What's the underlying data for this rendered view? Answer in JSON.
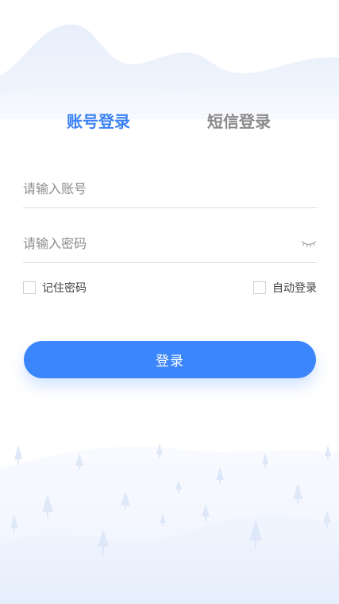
{
  "tabs": {
    "account_login": "账号登录",
    "sms_login": "短信登录"
  },
  "form": {
    "account_placeholder": "请输入账号",
    "account_value": "",
    "password_placeholder": "请输入密码",
    "password_value": "",
    "remember_password": "记住密码",
    "auto_login": "自动登录",
    "remember_checked": false,
    "auto_checked": false
  },
  "login_button": "登录",
  "icons": {
    "password_toggle": "eye-closed-icon"
  },
  "colors": {
    "accent": "#3b86fb",
    "active_tab": "#3b82f6",
    "inactive_tab": "#8a8a8a"
  }
}
